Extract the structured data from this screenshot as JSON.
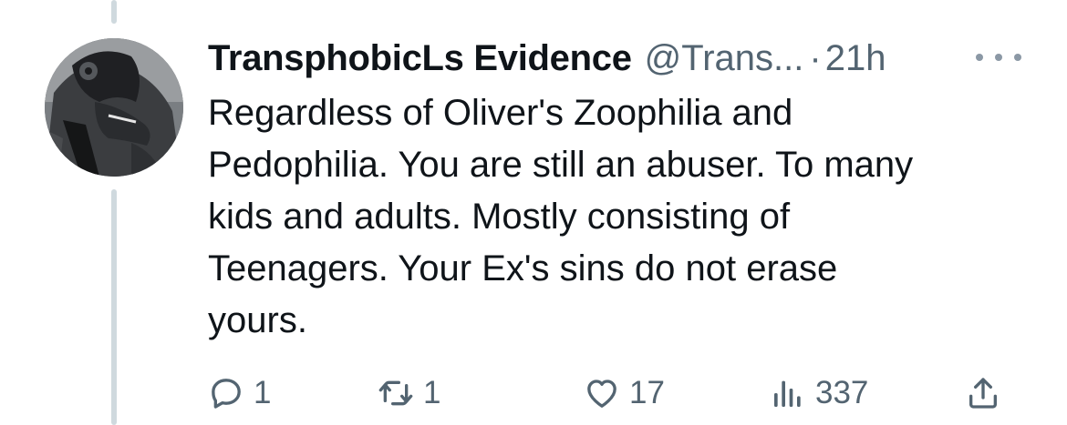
{
  "tweet": {
    "display_name": "TransphobicLs Evidence",
    "handle": "@Trans...",
    "separator": "·",
    "timestamp": "21h",
    "text": "Regardless of Oliver's Zoophilia and\nPedophilia. You are still an abuser. To many\nkids and adults. Mostly consisting of\nTeenagers. Your Ex's sins do not erase\nyours."
  },
  "actions": {
    "reply_count": "1",
    "retweet_count": "1",
    "like_count": "17",
    "view_count": "337"
  },
  "icons": {
    "reply": "reply-icon",
    "retweet": "retweet-icon",
    "like": "heart-icon",
    "views": "views-icon",
    "share": "share-icon",
    "more": "more-icon"
  },
  "colors": {
    "text_primary": "#0f1419",
    "text_secondary": "#536471",
    "thread_line": "#cfd9de"
  }
}
